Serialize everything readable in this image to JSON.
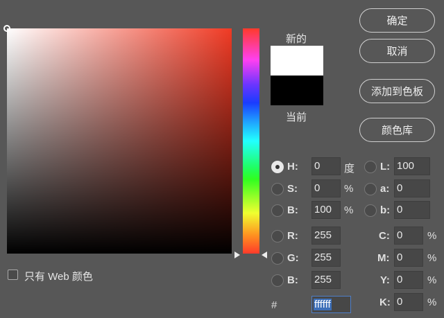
{
  "buttons": {
    "ok": "确定",
    "cancel": "取消",
    "add_swatch": "添加到色板",
    "libraries": "颜色库"
  },
  "swatch": {
    "new_label": "新的",
    "current_label": "当前",
    "new_color": "#ffffff",
    "current_color": "#000000"
  },
  "web_only_label": "只有 Web 颜色",
  "fields": {
    "H": {
      "label": "H:",
      "value": "0",
      "unit": "度",
      "selected": true
    },
    "S": {
      "label": "S:",
      "value": "0",
      "unit": "%"
    },
    "Bv": {
      "label": "B:",
      "value": "100",
      "unit": "%"
    },
    "R": {
      "label": "R:",
      "value": "255"
    },
    "G": {
      "label": "G:",
      "value": "255"
    },
    "B": {
      "label": "B:",
      "value": "255"
    },
    "L": {
      "label": "L:",
      "value": "100"
    },
    "a": {
      "label": "a:",
      "value": "0"
    },
    "b": {
      "label": "b:",
      "value": "0"
    },
    "C": {
      "label": "C:",
      "value": "0",
      "unit": "%"
    },
    "M": {
      "label": "M:",
      "value": "0",
      "unit": "%"
    },
    "Y": {
      "label": "Y:",
      "value": "0",
      "unit": "%"
    },
    "K": {
      "label": "K:",
      "value": "0",
      "unit": "%"
    }
  },
  "hex": {
    "label": "#",
    "value": "ffffff"
  }
}
